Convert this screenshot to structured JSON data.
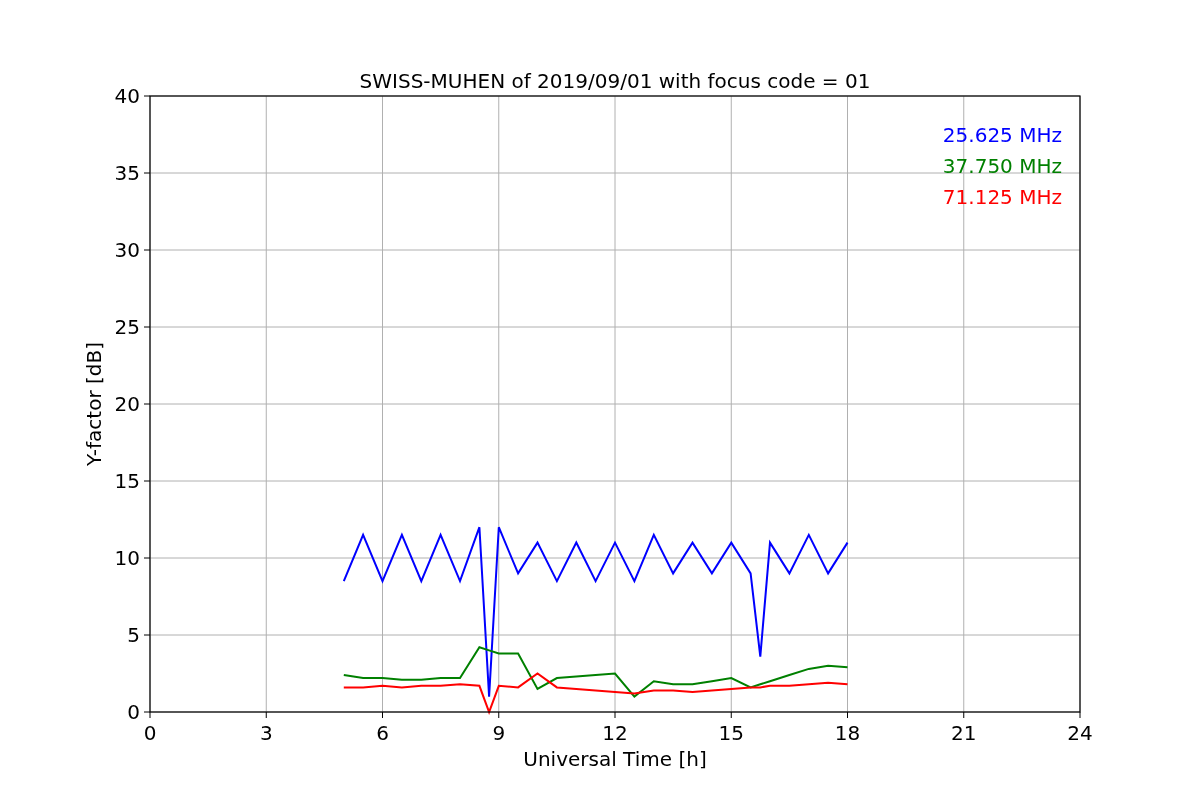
{
  "chart_data": {
    "type": "line",
    "title": "SWISS-MUHEN of 2019/09/01 with focus code = 01",
    "xlabel": "Universal Time [h]",
    "ylabel": "Y-factor [dB]",
    "xlim": [
      0,
      24
    ],
    "ylim": [
      0,
      40
    ],
    "grid": true,
    "xticks": [
      0,
      3,
      6,
      9,
      12,
      15,
      18,
      21,
      24
    ],
    "yticks": [
      0,
      5,
      10,
      15,
      20,
      25,
      30,
      35,
      40
    ],
    "x": [
      5,
      5.5,
      6,
      6.5,
      7,
      7.5,
      8,
      8.5,
      8.75,
      9,
      9.5,
      10,
      10.5,
      11,
      11.5,
      12,
      12.5,
      13,
      13.5,
      14,
      14.5,
      15,
      15.5,
      15.75,
      16,
      16.5,
      17,
      17.5,
      18
    ],
    "series": [
      {
        "name": "25.625 MHz",
        "color": "#0000ff",
        "values": [
          8.5,
          11.5,
          8.5,
          11.5,
          8.5,
          11.5,
          8.5,
          12,
          1,
          12,
          9,
          11,
          8.5,
          11,
          8.5,
          11,
          8.5,
          11.5,
          9,
          11,
          9,
          11,
          9,
          3.6,
          11,
          9,
          11.5,
          9,
          11
        ]
      },
      {
        "name": "37.750 MHz",
        "color": "#008000",
        "values": [
          2.4,
          2.2,
          2.2,
          2.1,
          2.1,
          2.2,
          2.2,
          4.2,
          4,
          3.8,
          3.8,
          1.5,
          2.2,
          2.3,
          2.4,
          2.5,
          1.0,
          2.0,
          1.8,
          1.8,
          2.0,
          2.2,
          1.6,
          1.8,
          2.0,
          2.4,
          2.8,
          3.0,
          2.9
        ]
      },
      {
        "name": "71.125 MHz",
        "color": "#ff0000",
        "values": [
          1.6,
          1.6,
          1.7,
          1.6,
          1.7,
          1.7,
          1.8,
          1.7,
          0,
          1.7,
          1.6,
          2.5,
          1.6,
          1.5,
          1.4,
          1.3,
          1.2,
          1.4,
          1.4,
          1.3,
          1.4,
          1.5,
          1.6,
          1.6,
          1.7,
          1.7,
          1.8,
          1.9,
          1.8
        ]
      }
    ]
  }
}
